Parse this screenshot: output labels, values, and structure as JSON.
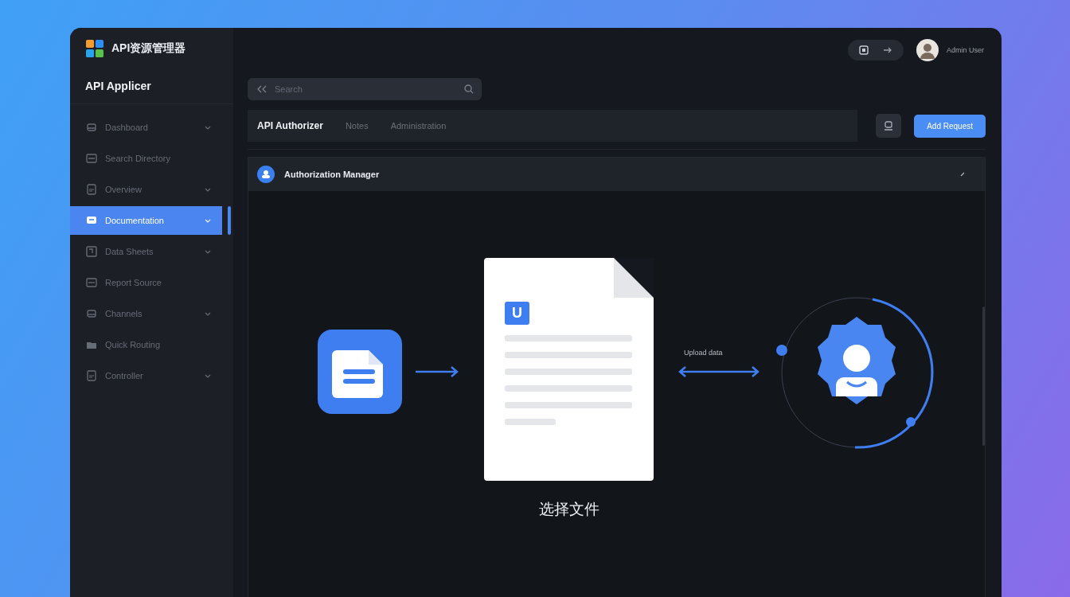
{
  "app": {
    "title": "API资源管理器",
    "section": "API Applicer"
  },
  "sidebar": {
    "items": [
      {
        "label": "Dashboard",
        "kind": "drive",
        "submenu": true,
        "selected": false
      },
      {
        "label": "Search Directory",
        "kind": "card",
        "submenu": false,
        "selected": false
      },
      {
        "label": "Overview",
        "kind": "doc",
        "submenu": true,
        "selected": false
      },
      {
        "label": "Documentation",
        "kind": "chat",
        "submenu": true,
        "selected": true
      },
      {
        "label": "Data Sheets",
        "kind": "frame",
        "submenu": true,
        "selected": false
      },
      {
        "label": "Report Source",
        "kind": "card",
        "submenu": false,
        "selected": false
      },
      {
        "label": "Channels",
        "kind": "drive",
        "submenu": true,
        "selected": false
      },
      {
        "label": "Quick Routing",
        "kind": "folder",
        "submenu": false,
        "selected": false
      },
      {
        "label": "Controller",
        "kind": "doc",
        "submenu": true,
        "selected": false
      }
    ]
  },
  "header": {
    "user_name": "Admin User",
    "search": {
      "placeholder": "Search"
    }
  },
  "toolbar": {
    "breadcrumbs": [
      {
        "label": "API Authorizer",
        "selected": true
      },
      {
        "label": "Notes",
        "selected": false
      },
      {
        "label": "Administration",
        "selected": false
      }
    ],
    "primary_button": "Add Request"
  },
  "panel": {
    "title": "Authorization Manager",
    "badge": "U",
    "arrow_label": "Upload data",
    "caption": "选择文件"
  }
}
